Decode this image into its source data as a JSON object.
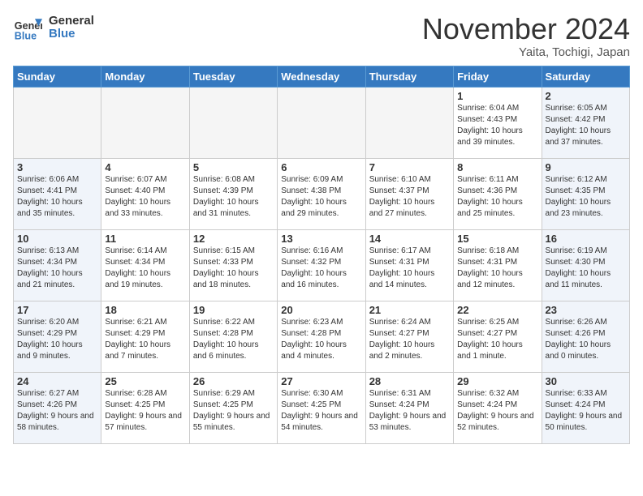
{
  "header": {
    "logo_general": "General",
    "logo_blue": "Blue",
    "month_title": "November 2024",
    "subtitle": "Yaita, Tochigi, Japan"
  },
  "days_of_week": [
    "Sunday",
    "Monday",
    "Tuesday",
    "Wednesday",
    "Thursday",
    "Friday",
    "Saturday"
  ],
  "weeks": [
    [
      {
        "day": "",
        "info": "",
        "empty": true
      },
      {
        "day": "",
        "info": "",
        "empty": true
      },
      {
        "day": "",
        "info": "",
        "empty": true
      },
      {
        "day": "",
        "info": "",
        "empty": true
      },
      {
        "day": "",
        "info": "",
        "empty": true
      },
      {
        "day": "1",
        "info": "Sunrise: 6:04 AM\nSunset: 4:43 PM\nDaylight: 10 hours and 39 minutes."
      },
      {
        "day": "2",
        "info": "Sunrise: 6:05 AM\nSunset: 4:42 PM\nDaylight: 10 hours and 37 minutes.",
        "weekend": true
      }
    ],
    [
      {
        "day": "3",
        "info": "Sunrise: 6:06 AM\nSunset: 4:41 PM\nDaylight: 10 hours and 35 minutes.",
        "weekend": true
      },
      {
        "day": "4",
        "info": "Sunrise: 6:07 AM\nSunset: 4:40 PM\nDaylight: 10 hours and 33 minutes."
      },
      {
        "day": "5",
        "info": "Sunrise: 6:08 AM\nSunset: 4:39 PM\nDaylight: 10 hours and 31 minutes."
      },
      {
        "day": "6",
        "info": "Sunrise: 6:09 AM\nSunset: 4:38 PM\nDaylight: 10 hours and 29 minutes."
      },
      {
        "day": "7",
        "info": "Sunrise: 6:10 AM\nSunset: 4:37 PM\nDaylight: 10 hours and 27 minutes."
      },
      {
        "day": "8",
        "info": "Sunrise: 6:11 AM\nSunset: 4:36 PM\nDaylight: 10 hours and 25 minutes."
      },
      {
        "day": "9",
        "info": "Sunrise: 6:12 AM\nSunset: 4:35 PM\nDaylight: 10 hours and 23 minutes.",
        "weekend": true
      }
    ],
    [
      {
        "day": "10",
        "info": "Sunrise: 6:13 AM\nSunset: 4:34 PM\nDaylight: 10 hours and 21 minutes.",
        "weekend": true
      },
      {
        "day": "11",
        "info": "Sunrise: 6:14 AM\nSunset: 4:34 PM\nDaylight: 10 hours and 19 minutes."
      },
      {
        "day": "12",
        "info": "Sunrise: 6:15 AM\nSunset: 4:33 PM\nDaylight: 10 hours and 18 minutes."
      },
      {
        "day": "13",
        "info": "Sunrise: 6:16 AM\nSunset: 4:32 PM\nDaylight: 10 hours and 16 minutes."
      },
      {
        "day": "14",
        "info": "Sunrise: 6:17 AM\nSunset: 4:31 PM\nDaylight: 10 hours and 14 minutes."
      },
      {
        "day": "15",
        "info": "Sunrise: 6:18 AM\nSunset: 4:31 PM\nDaylight: 10 hours and 12 minutes."
      },
      {
        "day": "16",
        "info": "Sunrise: 6:19 AM\nSunset: 4:30 PM\nDaylight: 10 hours and 11 minutes.",
        "weekend": true
      }
    ],
    [
      {
        "day": "17",
        "info": "Sunrise: 6:20 AM\nSunset: 4:29 PM\nDaylight: 10 hours and 9 minutes.",
        "weekend": true
      },
      {
        "day": "18",
        "info": "Sunrise: 6:21 AM\nSunset: 4:29 PM\nDaylight: 10 hours and 7 minutes."
      },
      {
        "day": "19",
        "info": "Sunrise: 6:22 AM\nSunset: 4:28 PM\nDaylight: 10 hours and 6 minutes."
      },
      {
        "day": "20",
        "info": "Sunrise: 6:23 AM\nSunset: 4:28 PM\nDaylight: 10 hours and 4 minutes."
      },
      {
        "day": "21",
        "info": "Sunrise: 6:24 AM\nSunset: 4:27 PM\nDaylight: 10 hours and 2 minutes."
      },
      {
        "day": "22",
        "info": "Sunrise: 6:25 AM\nSunset: 4:27 PM\nDaylight: 10 hours and 1 minute."
      },
      {
        "day": "23",
        "info": "Sunrise: 6:26 AM\nSunset: 4:26 PM\nDaylight: 10 hours and 0 minutes.",
        "weekend": true
      }
    ],
    [
      {
        "day": "24",
        "info": "Sunrise: 6:27 AM\nSunset: 4:26 PM\nDaylight: 9 hours and 58 minutes.",
        "weekend": true
      },
      {
        "day": "25",
        "info": "Sunrise: 6:28 AM\nSunset: 4:25 PM\nDaylight: 9 hours and 57 minutes."
      },
      {
        "day": "26",
        "info": "Sunrise: 6:29 AM\nSunset: 4:25 PM\nDaylight: 9 hours and 55 minutes."
      },
      {
        "day": "27",
        "info": "Sunrise: 6:30 AM\nSunset: 4:25 PM\nDaylight: 9 hours and 54 minutes."
      },
      {
        "day": "28",
        "info": "Sunrise: 6:31 AM\nSunset: 4:24 PM\nDaylight: 9 hours and 53 minutes."
      },
      {
        "day": "29",
        "info": "Sunrise: 6:32 AM\nSunset: 4:24 PM\nDaylight: 9 hours and 52 minutes."
      },
      {
        "day": "30",
        "info": "Sunrise: 6:33 AM\nSunset: 4:24 PM\nDaylight: 9 hours and 50 minutes.",
        "weekend": true
      }
    ]
  ]
}
